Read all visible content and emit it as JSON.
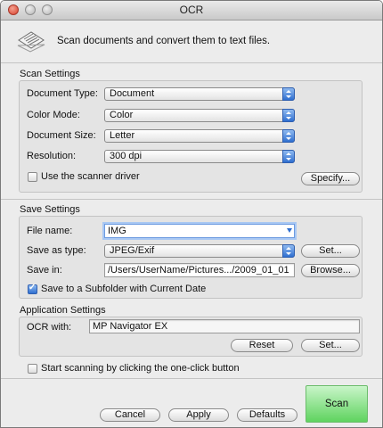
{
  "window": {
    "title": "OCR"
  },
  "header": {
    "description": "Scan documents and convert them to text files."
  },
  "scan_settings": {
    "section_title": "Scan Settings",
    "document_type_label": "Document Type:",
    "document_type_value": "Document",
    "color_mode_label": "Color Mode:",
    "color_mode_value": "Color",
    "document_size_label": "Document Size:",
    "document_size_value": "Letter",
    "resolution_label": "Resolution:",
    "resolution_value": "300 dpi",
    "use_driver_label": "Use the scanner driver",
    "use_driver_checked": false,
    "specify_button": "Specify..."
  },
  "save_settings": {
    "section_title": "Save Settings",
    "file_name_label": "File name:",
    "file_name_value": "IMG",
    "save_as_type_label": "Save as  type:",
    "save_as_type_value": "JPEG/Exif",
    "set_button": "Set...",
    "save_in_label": "Save in:",
    "save_in_value": "/Users/UserName/Pictures.../2009_01_01",
    "browse_button": "Browse...",
    "subfolder_label": "Save to a Subfolder with Current Date",
    "subfolder_checked": true
  },
  "application_settings": {
    "section_title": "Application Settings",
    "ocr_with_label": "OCR with:",
    "ocr_with_value": "MP Navigator EX",
    "reset_button": "Reset",
    "set_button": "Set..."
  },
  "one_click": {
    "label": "Start scanning by clicking the one-click button",
    "checked": false
  },
  "footer": {
    "cancel_button": "Cancel",
    "apply_button": "Apply",
    "defaults_button": "Defaults",
    "scan_button": "Scan"
  },
  "colors": {
    "accent_blue": "#2f6fd0",
    "scan_green": "#5fd35f",
    "window_bg": "#ececec"
  }
}
